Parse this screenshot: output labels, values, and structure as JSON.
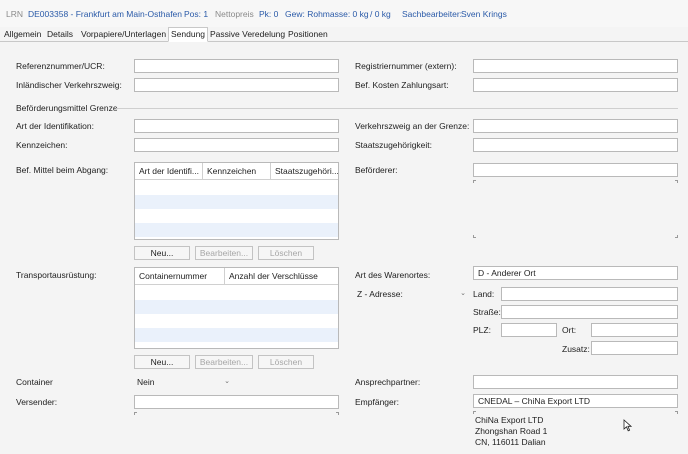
{
  "header": {
    "lrn_label": "LRN",
    "lrn_value": "DE003358 - Frankfurt am Main-Osthafen",
    "pos_label": "Pos: 1",
    "nettopreis_label": "Nettopreis",
    "pk_label": "Pk: 0",
    "gew_label": "Gew: Rohmasse: 0 kg",
    "gew_sep": "/ 0 kg",
    "sachbearbeiter_label": "Sachbearbeiter:",
    "sachbearbeiter_value": "Sven Krings"
  },
  "tabs": [
    {
      "label": "Allgemein",
      "active": false
    },
    {
      "label": "Details",
      "active": false
    },
    {
      "label": "Vorpapiere/Unterlagen",
      "active": false
    },
    {
      "label": "Sendung",
      "active": true
    },
    {
      "label": "Passive Veredelung",
      "active": false
    },
    {
      "label": "Positionen",
      "active": false
    }
  ],
  "form": {
    "referenz_label": "Referenznummer/UCR:",
    "registrier_label": "Registriernummer (extern):",
    "inlaend_label": "Inländischer Verkehrszweig:",
    "befkosten_label": "Bef. Kosten Zahlungsart:",
    "section_grenze": "Beförderungsmittel Grenze",
    "art_ident_label": "Art der Identifikation:",
    "verkehrszweig_grenze_label": "Verkehrszweig an der Grenze:",
    "kennzeichen_label": "Kennzeichen:",
    "staatszug_label": "Staatszugehörigkeit:",
    "befmittel_label": "Bef. Mittel beim Abgang:",
    "befoerderer_label": "Beförderer:",
    "transport_label": "Transportausrüstung:",
    "art_warenort_label": "Art des Warenortes:",
    "art_warenort_value": "D - Anderer Ort",
    "adresse_combo": "Z - Adresse:",
    "land_label": "Land:",
    "strasse_label": "Straße:",
    "plz_label": "PLZ:",
    "ort_label": "Ort:",
    "zusatz_label": "Zusatz:",
    "container_label": "Container",
    "container_value": "Nein",
    "ansprech_label": "Ansprechpartner:",
    "versender_label": "Versender:",
    "empfaenger_label": "Empfänger:",
    "empfaenger_value": "CNEDAL – ChiNa Export LTD",
    "empfaenger_address": [
      "ChiNa Export LTD",
      "Zhongshan Road 1",
      "CN, 116011 Dalian"
    ]
  },
  "grid_befmittel": {
    "columns": [
      "Art der Identifi...",
      "Kennzeichen",
      "Staatszugehöri..."
    ]
  },
  "grid_transport": {
    "columns": [
      "Containernummer",
      "Anzahl der Verschlüsse"
    ]
  },
  "buttons": {
    "neu": "Neu...",
    "bearbeiten": "Bearbeiten...",
    "loeschen": "Löschen"
  }
}
